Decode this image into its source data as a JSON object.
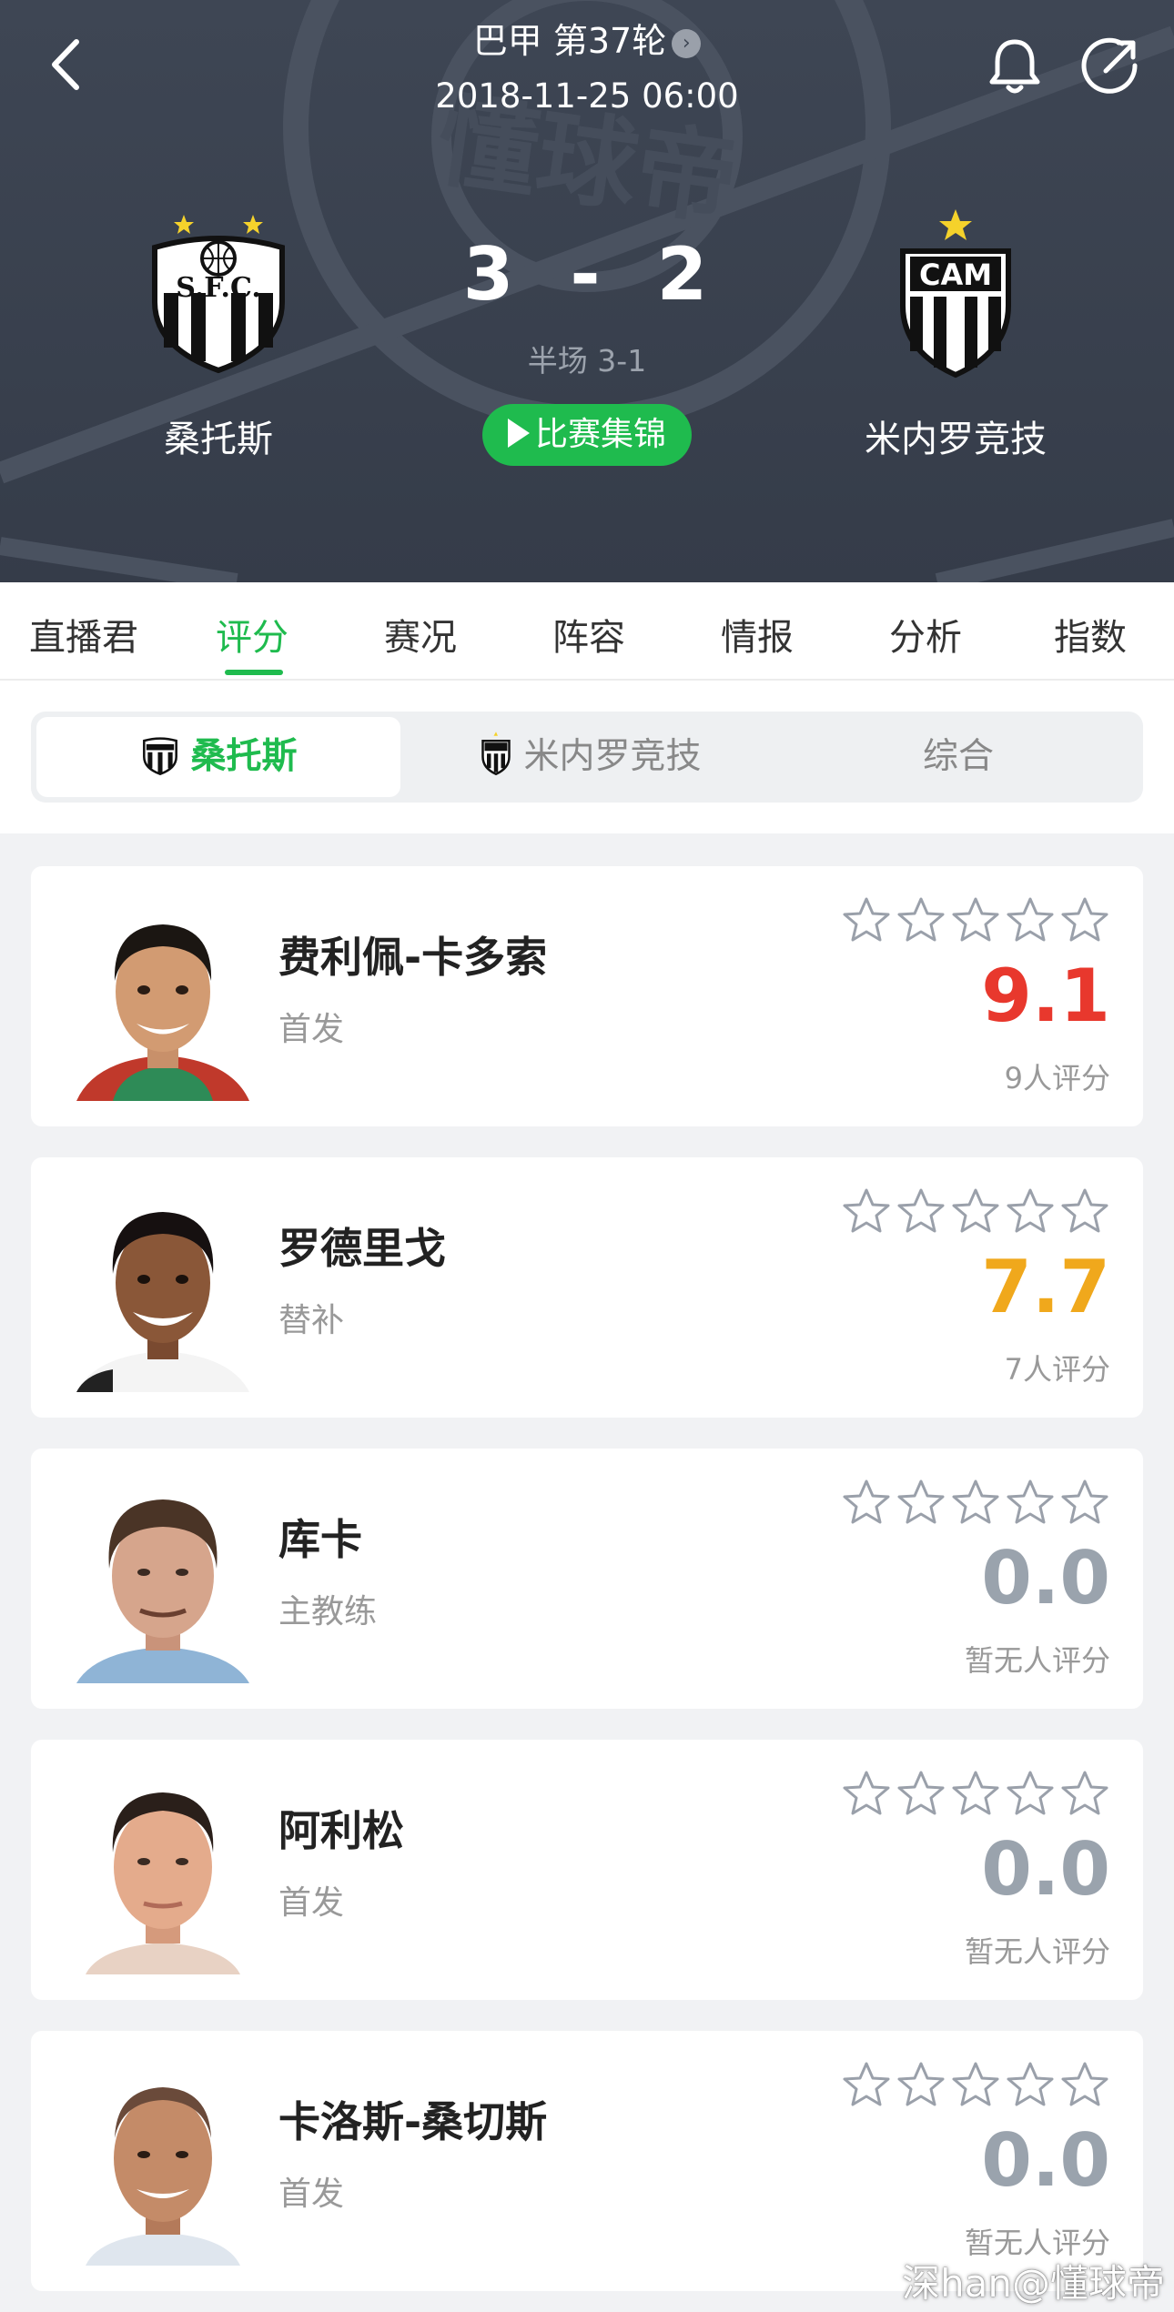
{
  "header": {
    "league_round": "巴甲 第37轮",
    "match_time": "2018-11-25 06:00",
    "home_team": "桑托斯",
    "away_team": "米内罗竞技",
    "home_score": "3",
    "score_separator": "-",
    "away_score": "2",
    "halftime": "半场 3-1",
    "highlights_label": "比赛集锦",
    "home_logo_text": "S.F.C.",
    "away_logo_text": "CAM",
    "watermark_text": "懂球帝"
  },
  "tabs": [
    {
      "label": "直播君",
      "active": false
    },
    {
      "label": "评分",
      "active": true
    },
    {
      "label": "赛况",
      "active": false
    },
    {
      "label": "阵容",
      "active": false
    },
    {
      "label": "情报",
      "active": false
    },
    {
      "label": "分析",
      "active": false
    },
    {
      "label": "指数",
      "active": false
    }
  ],
  "team_switch": {
    "home": "桑托斯",
    "away": "米内罗竞技",
    "all": "综合",
    "selected": "home"
  },
  "players": [
    {
      "name": "费利佩-卡多索",
      "role": "首发",
      "rating": "9.1",
      "rating_count": "9人评分",
      "rating_color": "#e8382d"
    },
    {
      "name": "罗德里戈",
      "role": "替补",
      "rating": "7.7",
      "rating_count": "7人评分",
      "rating_color": "#f0a81c"
    },
    {
      "name": "库卡",
      "role": "主教练",
      "rating": "0.0",
      "rating_count": "暂无人评分",
      "rating_color": "#9aa3ad"
    },
    {
      "name": "阿利松",
      "role": "首发",
      "rating": "0.0",
      "rating_count": "暂无人评分",
      "rating_color": "#9aa3ad"
    },
    {
      "name": "卡洛斯-桑切斯",
      "role": "首发",
      "rating": "0.0",
      "rating_count": "暂无人评分",
      "rating_color": "#9aa3ad"
    }
  ],
  "footer": {
    "watermark": "深han@懂球帝"
  },
  "colors": {
    "accent": "#1fbb4e",
    "header_bg": "#3b4350"
  }
}
